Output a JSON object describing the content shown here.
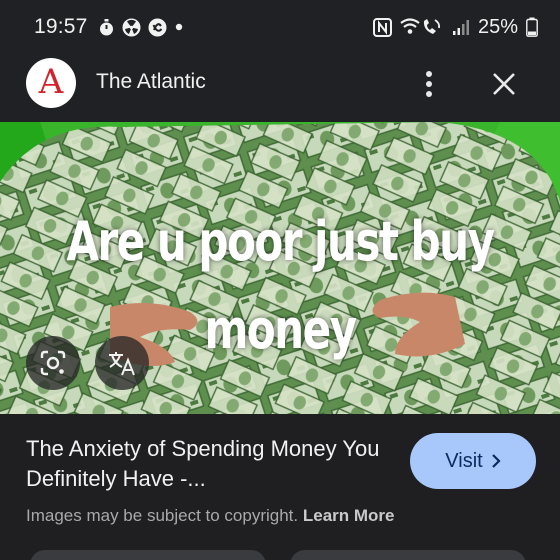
{
  "status_bar": {
    "time": "19:57",
    "battery_percent": "25%",
    "icons": [
      "timer-icon",
      "radiation-icon",
      "sync-icon",
      "notification-dot-icon",
      "nfc-icon",
      "wifi-call-icon",
      "signal-icon",
      "battery-icon"
    ]
  },
  "header": {
    "site_logo_letter": "A",
    "site_name": "The Atlantic",
    "more_icon": "more-vert-icon",
    "close_icon": "close-icon"
  },
  "image": {
    "meme_line1": "Are u poor just buy",
    "meme_line2": "money",
    "lens_icon": "google-lens-icon",
    "translate_icon": "translate-icon"
  },
  "caption": {
    "title": "The Anxiety of Spending Money You Definitely Have -...",
    "visit_label": "Visit",
    "copyright_text": "Images may be subject to copyright.",
    "learn_more": "Learn More"
  },
  "colors": {
    "background": "#1f1f21",
    "visit_button": "#a8c7fa",
    "logo_red": "#d2232a",
    "image_green": "#2e8f1a"
  }
}
